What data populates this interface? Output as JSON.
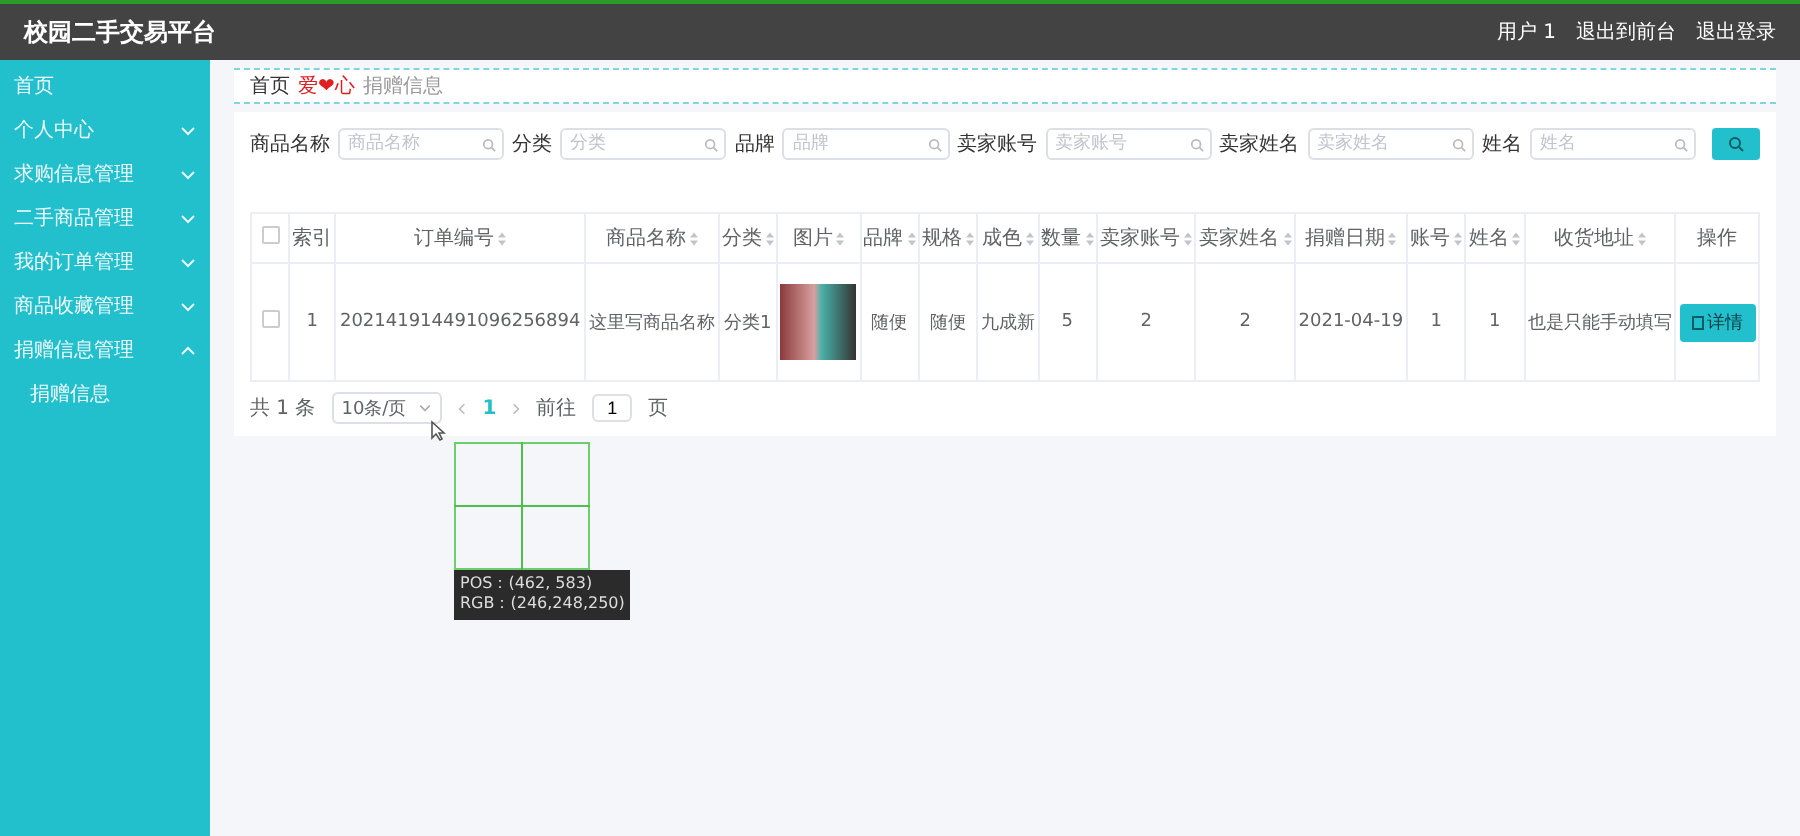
{
  "header": {
    "title": "校园二手交易平台",
    "links": [
      "用户 1",
      "退出到前台",
      "退出登录"
    ]
  },
  "sidebar": {
    "items": [
      {
        "label": "首页",
        "kind": "link"
      },
      {
        "label": "个人中心",
        "kind": "menu",
        "expanded": false
      },
      {
        "label": "求购信息管理",
        "kind": "menu",
        "expanded": false
      },
      {
        "label": "二手商品管理",
        "kind": "menu",
        "expanded": false
      },
      {
        "label": "我的订单管理",
        "kind": "menu",
        "expanded": false
      },
      {
        "label": "商品收藏管理",
        "kind": "menu",
        "expanded": false
      },
      {
        "label": "捐赠信息管理",
        "kind": "menu",
        "expanded": true,
        "children": [
          {
            "label": "捐赠信息"
          }
        ]
      }
    ]
  },
  "breadcrumb": {
    "home": "首页",
    "separator": "爱❤心",
    "current": "捐赠信息"
  },
  "search": {
    "fields": [
      {
        "label": "商品名称",
        "placeholder": "商品名称"
      },
      {
        "label": "分类",
        "placeholder": "分类"
      },
      {
        "label": "品牌",
        "placeholder": "品牌"
      },
      {
        "label": "卖家账号",
        "placeholder": "卖家账号"
      },
      {
        "label": "卖家姓名",
        "placeholder": "卖家姓名"
      },
      {
        "label": "姓名",
        "placeholder": "姓名"
      }
    ]
  },
  "table": {
    "header_checked": false,
    "columns": [
      {
        "label": "索引",
        "kind": "plain"
      },
      {
        "label": "订单编号",
        "kind": "sortable"
      },
      {
        "label": "商品名称",
        "kind": "sortable"
      },
      {
        "label": "分类",
        "kind": "sortable"
      },
      {
        "label": "图片",
        "kind": "sortable"
      },
      {
        "label": "品牌",
        "kind": "sortable"
      },
      {
        "label": "规格",
        "kind": "sortable"
      },
      {
        "label": "成色",
        "kind": "sortable"
      },
      {
        "label": "数量",
        "kind": "sortable"
      },
      {
        "label": "卖家账号",
        "kind": "sortable"
      },
      {
        "label": "卖家姓名",
        "kind": "sortable"
      },
      {
        "label": "捐赠日期",
        "kind": "sortable"
      },
      {
        "label": "账号",
        "kind": "sortable"
      },
      {
        "label": "姓名",
        "kind": "sortable"
      },
      {
        "label": "收货地址",
        "kind": "sortable"
      },
      {
        "label": "操作",
        "kind": "plain"
      }
    ],
    "rows": [
      {
        "checked": false,
        "cells": [
          "1",
          "202141914491096256894",
          "这里写商品名称",
          "分类1",
          null,
          "随便",
          "随便",
          "九成新",
          "5",
          "2",
          "2",
          "2021-04-19",
          "1",
          "1",
          "也是只能手动填写"
        ],
        "action": "详情"
      }
    ]
  },
  "pagination": {
    "total": "共 1 条",
    "page_size": "10条/页",
    "pages": [
      {
        "label": "1",
        "selected": true
      }
    ],
    "goto_label": "前往",
    "goto_value": "1",
    "goto_suffix": "页"
  },
  "color_picker": {
    "pos": "POS：(462, 583)",
    "rgb": "RGB：(246,248,250)"
  }
}
